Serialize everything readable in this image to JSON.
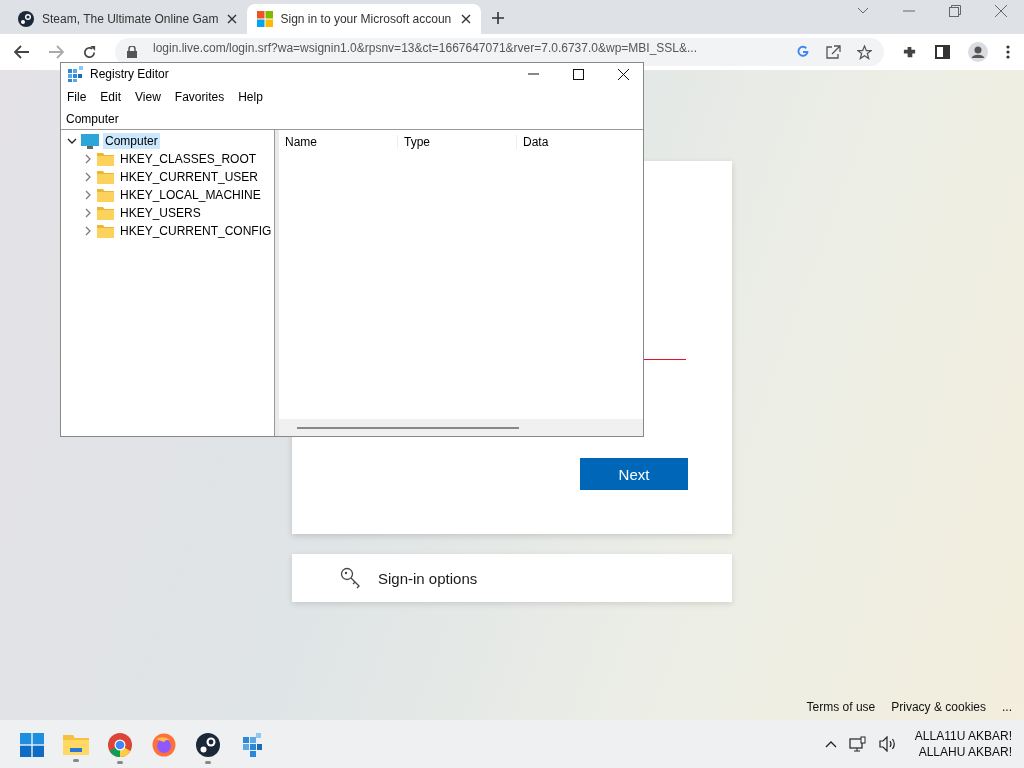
{
  "browser": {
    "tabs": [
      {
        "title": "Steam, The Ultimate Online Gam",
        "kind": "steam",
        "selected": false
      },
      {
        "title": "Sign in to your Microsoft accoun",
        "kind": "microsoft",
        "selected": true
      }
    ],
    "address": "login.live.com/login.srf?wa=wsignin1.0&rpsnv=13&ct=1667647071&rver=7.0.6737.0&wp=MBI_SSL&..."
  },
  "signin": {
    "next_button": "Next",
    "options": "Sign-in options"
  },
  "footer": [
    "Terms of use",
    "Privacy & cookies",
    "..."
  ],
  "registry": {
    "title": "Registry Editor",
    "menu": [
      "File",
      "Edit",
      "View",
      "Favorites",
      "Help"
    ],
    "path": "Computer",
    "tree": {
      "label": "Computer",
      "expanded": true,
      "selected": true,
      "children": [
        {
          "label": "HKEY_CLASSES_ROOT",
          "expanded": false,
          "selected": false
        },
        {
          "label": "HKEY_CURRENT_USER",
          "expanded": false,
          "selected": false
        },
        {
          "label": "HKEY_LOCAL_MACHINE",
          "expanded": false,
          "selected": false
        },
        {
          "label": "HKEY_USERS",
          "expanded": false,
          "selected": false
        },
        {
          "label": "HKEY_CURRENT_CONFIG",
          "expanded": false,
          "selected": false
        }
      ]
    },
    "columns": [
      "Name",
      "Type",
      "Data"
    ]
  },
  "taskbar": {
    "apps": [
      {
        "kind": "start",
        "running": false
      },
      {
        "kind": "files",
        "running": true
      },
      {
        "kind": "chrome",
        "running": true
      },
      {
        "kind": "firefox",
        "running": false
      },
      {
        "kind": "steam",
        "running": true
      },
      {
        "kind": "regedit",
        "running": false
      }
    ],
    "clock": [
      "ALLA11U AKBAR!",
      "ALLAHU AKBAR!"
    ]
  }
}
